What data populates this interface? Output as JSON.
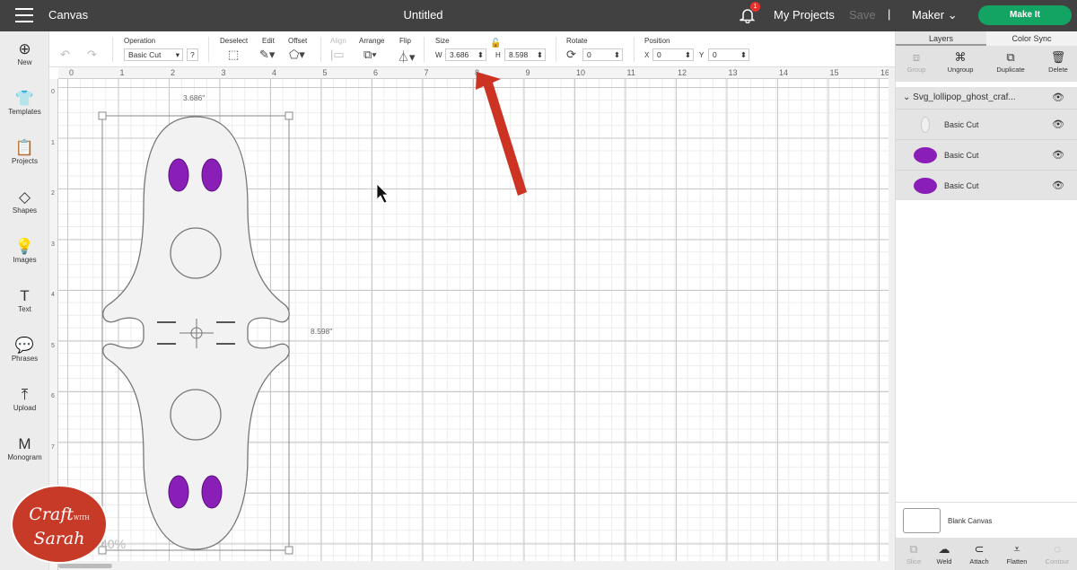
{
  "topbar": {
    "app": "Canvas",
    "title": "Untitled",
    "notifications": "1",
    "my_projects": "My Projects",
    "save": "Save",
    "separator": "|",
    "machine": "Maker",
    "make_it": "Make It"
  },
  "sidebar": [
    {
      "label": "New",
      "icon": "⊕"
    },
    {
      "label": "Templates",
      "icon": "👕"
    },
    {
      "label": "Projects",
      "icon": "📋"
    },
    {
      "label": "Shapes",
      "icon": "◇"
    },
    {
      "label": "Images",
      "icon": "💡"
    },
    {
      "label": "Text",
      "icon": "T"
    },
    {
      "label": "Phrases",
      "icon": "💬"
    },
    {
      "label": "Upload",
      "icon": "⤒"
    },
    {
      "label": "Monogram",
      "icon": "M"
    }
  ],
  "toolbar": {
    "operation_label": "Operation",
    "operation_value": "Basic Cut",
    "help": "?",
    "deselect": "Deselect",
    "edit": "Edit",
    "offset": "Offset",
    "align": "Align",
    "arrange": "Arrange",
    "flip": "Flip",
    "size": "Size",
    "w_label": "W",
    "w": "3.686",
    "h_label": "H",
    "h": "8.598",
    "rotate": "Rotate",
    "rotate_value": "0",
    "position": "Position",
    "x_label": "X",
    "x": "0",
    "y_label": "Y",
    "y": "0"
  },
  "ruler": {
    "top": [
      "0",
      "1",
      "2",
      "3",
      "4",
      "5",
      "6",
      "7",
      "8",
      "9",
      "10",
      "11",
      "12",
      "13",
      "14",
      "15",
      "16"
    ],
    "left": [
      "0",
      "1",
      "2",
      "3",
      "4",
      "5",
      "6",
      "7"
    ]
  },
  "canvas": {
    "width_dim": "3.686\"",
    "height_dim": "8.598\"",
    "zoom": "40%"
  },
  "panel": {
    "tabs": [
      "Layers",
      "Color Sync"
    ],
    "actions": [
      "Group",
      "Ungroup",
      "Duplicate",
      "Delete"
    ],
    "group_name": "Svg_lollipop_ghost_craf...",
    "layers": [
      {
        "label": "Basic Cut",
        "color": "#f0f0f0"
      },
      {
        "label": "Basic Cut",
        "color": "#8a1fb8"
      },
      {
        "label": "Basic Cut",
        "color": "#8a1fb8"
      }
    ],
    "blank_canvas": "Blank Canvas",
    "bottom_actions": [
      "Slice",
      "Weld",
      "Attach",
      "Flatten",
      "Contour"
    ]
  },
  "logo": {
    "line1": "Craft",
    "with": "WITH",
    "line2": "Sarah"
  }
}
